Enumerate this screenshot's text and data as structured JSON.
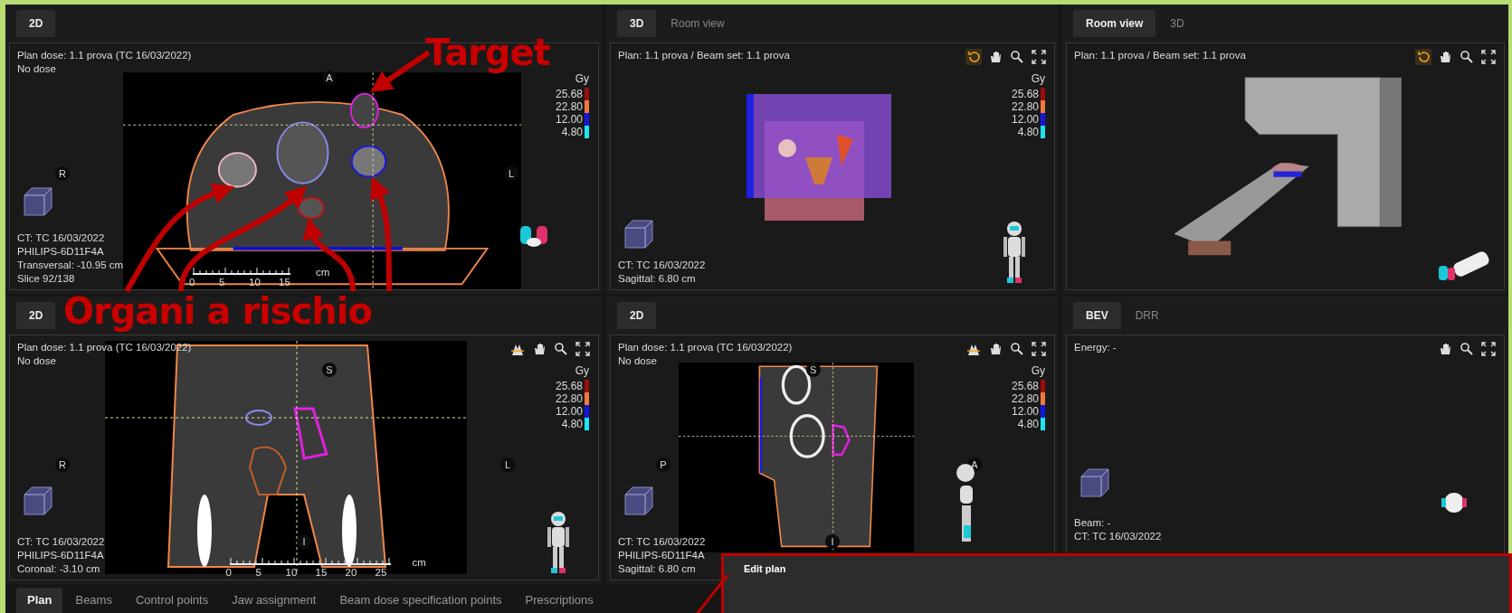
{
  "views": [
    {
      "kind": "transversal",
      "tabs": [
        {
          "label": "2D",
          "selected": true
        }
      ],
      "info_top": [
        "Plan dose: 1.1 prova (TC 16/03/2022)",
        "No dose"
      ],
      "legend": {
        "unit": "Gy",
        "entries": [
          {
            "value": "25.68",
            "color": "#9b0d0d"
          },
          {
            "value": "22.80",
            "color": "#f07a3c"
          },
          {
            "value": "12.00",
            "color": "#1414e0"
          },
          {
            "value": "4.80",
            "color": "#19e6f0"
          }
        ]
      },
      "orientation": {
        "top": "A",
        "left": "R",
        "right": "L"
      },
      "info_bottom": [
        "CT: TC 16/03/2022",
        "PHILIPS-6D11F4A",
        "Transversal: -10.95 cm",
        "Slice 92/138"
      ],
      "scale": {
        "ticks": [
          "0",
          "5",
          "10",
          "15"
        ],
        "unit": "cm"
      },
      "figure": {
        "kind": "head"
      }
    },
    {
      "kind": "volume",
      "tabs": [
        {
          "label": "3D",
          "selected": true
        },
        {
          "label": "Room view",
          "selected": false
        }
      ],
      "info_top": [
        "Plan: 1.1 prova / Beam set: 1.1 prova"
      ],
      "tools": [
        {
          "kind": "rotate",
          "active": true
        },
        {
          "kind": "pan",
          "active": false
        },
        {
          "kind": "zoom",
          "active": false
        },
        {
          "kind": "fit",
          "active": false
        }
      ],
      "legend": {
        "unit": "Gy",
        "entries": [
          {
            "value": "25.68",
            "color": "#9b0d0d"
          },
          {
            "value": "22.80",
            "color": "#f07a3c"
          },
          {
            "value": "12.00",
            "color": "#1414e0"
          },
          {
            "value": "4.80",
            "color": "#19e6f0"
          }
        ]
      },
      "info_bottom": [
        "CT: TC 16/03/2022",
        "Sagittal: 6.80 cm"
      ],
      "figure": {
        "kind": "standing"
      }
    },
    {
      "kind": "room",
      "tabs": [
        {
          "label": "Room view",
          "selected": true
        },
        {
          "label": "3D",
          "selected": false
        }
      ],
      "info_top": [
        "Plan: 1.1 prova / Beam set: 1.1 prova"
      ],
      "tools": [
        {
          "kind": "rotate",
          "active": true
        },
        {
          "kind": "pan",
          "active": false
        },
        {
          "kind": "zoom",
          "active": false
        },
        {
          "kind": "fit",
          "active": false
        }
      ],
      "figure": {
        "kind": "lying"
      }
    },
    {
      "kind": "coronal",
      "tabs": [
        {
          "label": "2D",
          "selected": true
        }
      ],
      "info_top": [
        "Plan dose: 1.1 prova (TC 16/03/2022)",
        "No dose"
      ],
      "tools": [
        {
          "kind": "beam",
          "active": false
        },
        {
          "kind": "pan",
          "active": false
        },
        {
          "kind": "zoom",
          "active": false
        },
        {
          "kind": "fit",
          "active": false
        }
      ],
      "legend": {
        "unit": "Gy",
        "entries": [
          {
            "value": "25.68",
            "color": "#9b0d0d"
          },
          {
            "value": "22.80",
            "color": "#f07a3c"
          },
          {
            "value": "12.00",
            "color": "#1414e0"
          },
          {
            "value": "4.80",
            "color": "#19e6f0"
          }
        ]
      },
      "orientation": {
        "top": "S",
        "left": "R",
        "right": "L",
        "bottom": "I"
      },
      "info_bottom": [
        "CT: TC 16/03/2022",
        "PHILIPS-6D11F4A",
        "Coronal: -3.10 cm"
      ],
      "scale": {
        "ticks": [
          "0",
          "5",
          "10",
          "15",
          "20",
          "25"
        ],
        "unit": "cm"
      },
      "figure": {
        "kind": "standing"
      }
    },
    {
      "kind": "sagittal",
      "tabs": [
        {
          "label": "2D",
          "selected": true
        }
      ],
      "info_top": [
        "Plan dose: 1.1 prova (TC 16/03/2022)",
        "No dose"
      ],
      "tools": [
        {
          "kind": "beam",
          "active": false
        },
        {
          "kind": "pan",
          "active": false
        },
        {
          "kind": "zoom",
          "active": false
        },
        {
          "kind": "fit",
          "active": false
        }
      ],
      "legend": {
        "unit": "Gy",
        "entries": [
          {
            "value": "25.68",
            "color": "#9b0d0d"
          },
          {
            "value": "22.80",
            "color": "#f07a3c"
          },
          {
            "value": "12.00",
            "color": "#1414e0"
          },
          {
            "value": "4.80",
            "color": "#19e6f0"
          }
        ]
      },
      "orientation": {
        "top": "S",
        "left": "P",
        "right": "A",
        "bottom": "I"
      },
      "info_bottom": [
        "CT: TC 16/03/2022",
        "PHILIPS-6D11F4A",
        "Sagittal: 6.80 cm"
      ],
      "figure": {
        "kind": "side"
      }
    },
    {
      "kind": "bev",
      "tabs": [
        {
          "label": "BEV",
          "selected": true
        },
        {
          "label": "DRR",
          "selected": false
        }
      ],
      "info_top": [
        "Energy: -"
      ],
      "tools": [
        {
          "kind": "pan",
          "active": false
        },
        {
          "kind": "zoom",
          "active": false
        },
        {
          "kind": "fit",
          "active": false
        }
      ],
      "info_bottom": [
        "Beam: -",
        "CT: TC 16/03/2022"
      ],
      "figure": {
        "kind": "top"
      }
    }
  ],
  "bottom_tabs": [
    {
      "label": "Plan",
      "selected": true
    },
    {
      "label": "Beams",
      "selected": false
    },
    {
      "label": "Control points",
      "selected": false
    },
    {
      "label": "Jaw assignment",
      "selected": false
    },
    {
      "label": "Beam dose specification points",
      "selected": false
    },
    {
      "label": "Prescriptions",
      "selected": false
    }
  ],
  "dialog": {
    "title": "Edit plan"
  },
  "annotations": [
    {
      "kind": "target",
      "text": "Target"
    },
    {
      "kind": "organs",
      "text": "Organi a rischio"
    }
  ]
}
